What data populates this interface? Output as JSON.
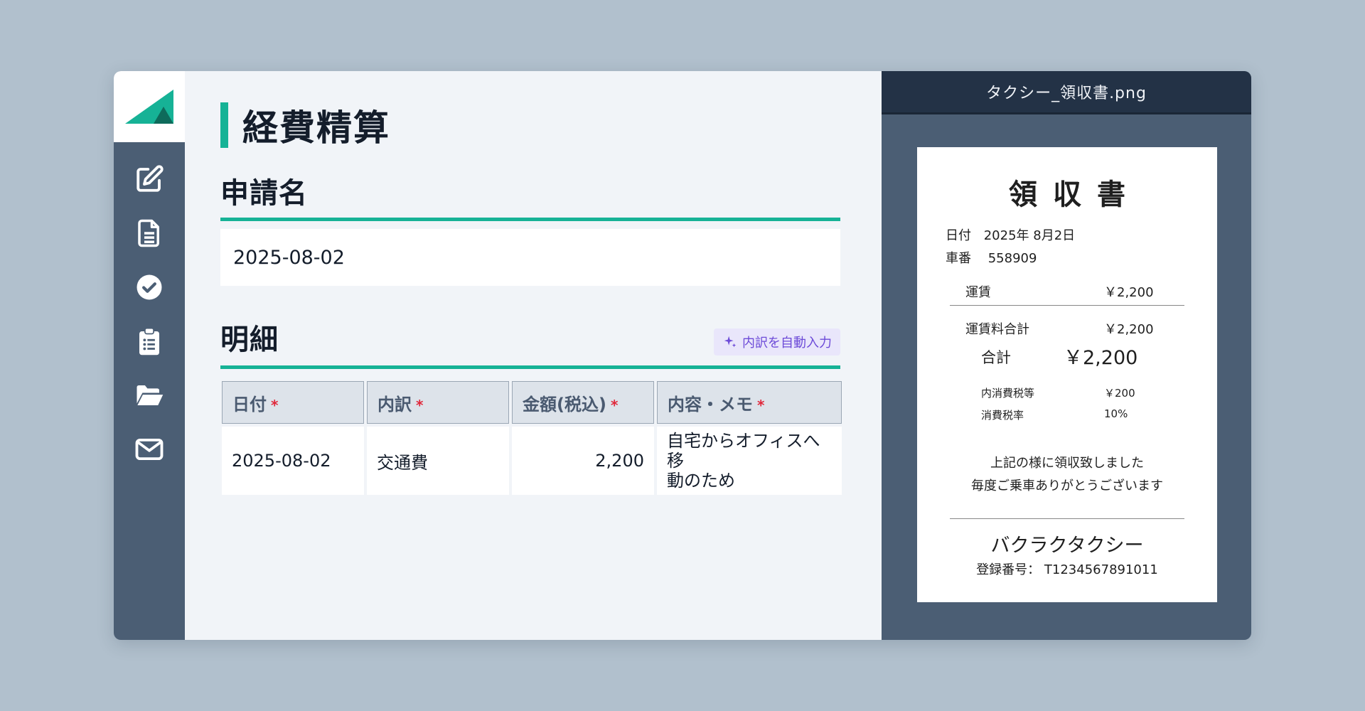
{
  "sidebar": {
    "icons": [
      "edit-icon",
      "document-icon",
      "check-circle-icon",
      "clipboard-list-icon",
      "folder-open-icon",
      "mail-icon"
    ]
  },
  "main": {
    "title": "経費精算",
    "application_name": {
      "heading": "申請名",
      "value": "2025-08-02"
    },
    "details": {
      "heading": "明細",
      "auto_fill_button": "内訳を自動入力",
      "columns": [
        "日付",
        "内訳",
        "金額(税込)",
        "内容・メモ"
      ],
      "required_mark": "*",
      "rows": [
        {
          "date": "2025-08-02",
          "category": "交通費",
          "amount": "2,200",
          "memo_line1": "自宅からオフィスへ移",
          "memo_line2": "動のため"
        }
      ]
    }
  },
  "preview": {
    "filename": "タクシー_領収書.png",
    "receipt": {
      "title": "領収書",
      "date_label": "日付",
      "date_value": "2025年 8月2日",
      "car_label": "車番",
      "car_value": "558909",
      "fare_label": "運賃",
      "fare_value": "￥2,200",
      "fare_total_label": "運賃料合計",
      "fare_total_value": "￥2,200",
      "total_label": "合計",
      "total_value": "￥2,200",
      "tax_label": "内消費税等",
      "tax_value": "￥200",
      "tax_rate_label": "消費税率",
      "tax_rate_value": "10%",
      "message_line1": "上記の様に領収致しました",
      "message_line2": "毎度ご乗車ありがとうございます",
      "company": "バクラクタクシー",
      "registration": "登録番号： T1234567891011"
    }
  },
  "colors": {
    "accent": "#16b296",
    "sidebar": "#4b5e74",
    "preview_header": "#233246",
    "required": "#e0283b",
    "ai_button": "#6d4bd8"
  }
}
